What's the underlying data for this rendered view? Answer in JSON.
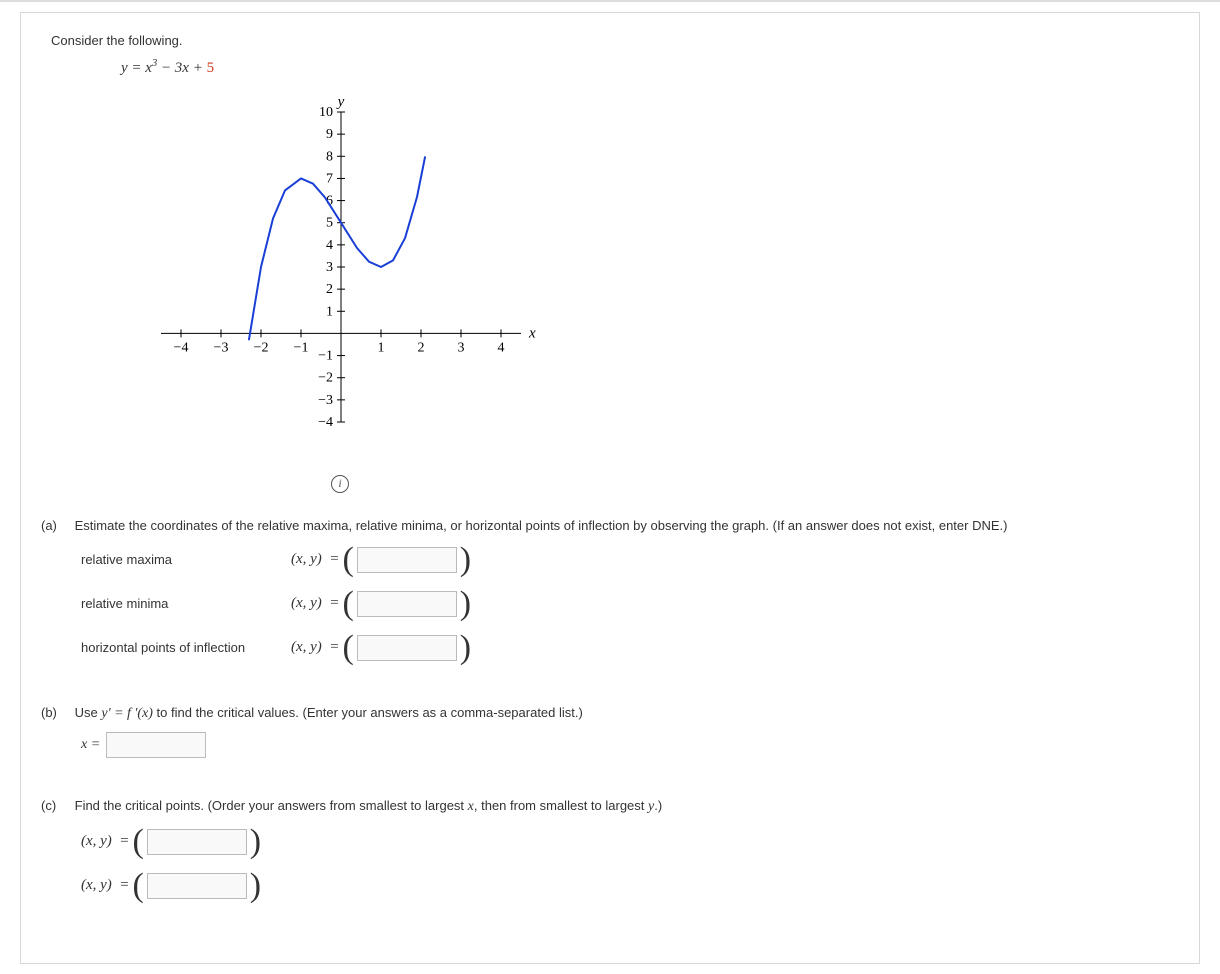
{
  "intro": "Consider the following.",
  "equation": {
    "lhs": "y = x",
    "exp": "3",
    "mid": " − 3x + ",
    "constant": "5"
  },
  "info_tooltip": "i",
  "part_a": {
    "label": "(a)",
    "prompt": "Estimate the coordinates of the relative maxima, relative minima, or horizontal points of inflection by observing the graph. (If an answer does not exist, enter DNE.)",
    "rows": [
      {
        "name": "relative maxima",
        "xy": "(x, y)  ="
      },
      {
        "name": "relative minima",
        "xy": "(x, y)  ="
      },
      {
        "name": "horizontal points of inflection",
        "xy": "(x, y)  ="
      }
    ]
  },
  "part_b": {
    "label": "(b)",
    "prompt_pre": "Use ",
    "prompt_eq": "y' = f '(x)",
    "prompt_post": " to find the critical values. (Enter your answers as a comma-separated list.)",
    "x_eq": "x ="
  },
  "part_c": {
    "label": "(c)",
    "prompt": "Find the critical points. (Order your answers from smallest to largest x, then from smallest to largest y.)",
    "rows": [
      {
        "xy": "(x, y)  ="
      },
      {
        "xy": "(x, y)  ="
      }
    ]
  },
  "chart_data": {
    "type": "line",
    "title": "",
    "xlabel": "x",
    "ylabel": "y",
    "xlim": [
      -4.5,
      4.5
    ],
    "ylim": [
      -4,
      10
    ],
    "xticks": [
      -4,
      -3,
      -2,
      -1,
      1,
      2,
      3,
      4
    ],
    "yticks": [
      -4,
      -3,
      -2,
      -1,
      1,
      2,
      3,
      4,
      5,
      6,
      7,
      8,
      9,
      10
    ],
    "series": [
      {
        "name": "y = x^3 - 3x + 5",
        "x": [
          -2.3,
          -2.0,
          -1.7,
          -1.4,
          -1.0,
          -0.7,
          -0.4,
          0.0,
          0.4,
          0.7,
          1.0,
          1.3,
          1.6,
          1.9,
          2.1
        ],
        "y": [
          -0.27,
          3.0,
          5.19,
          6.46,
          7.0,
          6.76,
          6.14,
          5.0,
          3.86,
          3.24,
          3.0,
          3.3,
          4.3,
          6.16,
          7.96
        ]
      }
    ]
  }
}
